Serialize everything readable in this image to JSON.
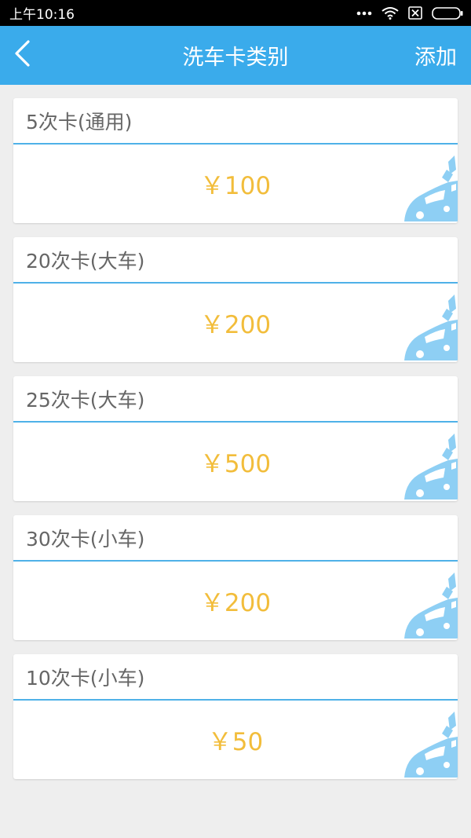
{
  "status_bar": {
    "time": "上午10:16",
    "icons": [
      "more-dots-icon",
      "wifi-icon",
      "sim-off-icon",
      "battery-icon"
    ]
  },
  "nav": {
    "back_icon": "chevron-left-icon",
    "title": "洗车卡类别",
    "add_label": "添加"
  },
  "cards": [
    {
      "name": "5次卡(通用)",
      "price": "￥100"
    },
    {
      "name": "20次卡(大车)",
      "price": "￥200"
    },
    {
      "name": "25次卡(大车)",
      "price": "￥500"
    },
    {
      "name": "30次卡(小车)",
      "price": "￥200"
    },
    {
      "name": "10次卡(小车)",
      "price": "￥50"
    }
  ],
  "colors": {
    "accent": "#3aabeb",
    "divider": "#4fb1e8",
    "price": "#f2bd3b",
    "car_icon": "#8ecff4",
    "background": "#eeeeee"
  }
}
